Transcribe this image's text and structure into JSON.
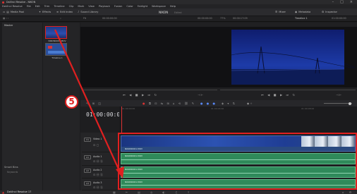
{
  "app": {
    "window_title": "DaVinci Resolve - NIKON",
    "menu": [
      "DaVinci Resolve",
      "File",
      "Edit",
      "Trim",
      "Timeline",
      "Clip",
      "Mark",
      "View",
      "Playback",
      "Fusion",
      "Color",
      "Fairlight",
      "Workspace",
      "Help"
    ],
    "project_name": "NIKON",
    "project_status": "Edited"
  },
  "toolbar": {
    "media_pool": "Media Pool",
    "effects": "Effects",
    "edit_index": "Edit Index",
    "sound_library": "Sound Library",
    "mixer": "Mixer",
    "metadata": "Metadata",
    "inspector": "Inspector"
  },
  "media_pool": {
    "master_label": "Master",
    "smart_bins_label": "Smart Bins",
    "keywords_label": "Keywords",
    "clips": [
      {
        "label": "NIKON0001.MOV"
      },
      {
        "label": "Timeline 1"
      }
    ]
  },
  "source_viewer": {
    "zoom": "Fit",
    "timecode": "00:00:00:00",
    "timecode_right": "00:00:00:00"
  },
  "timeline_viewer": {
    "zoom": "77%",
    "timecode_left": "00:00:17:09",
    "timeline_name": "Timeline 1",
    "timecode_right": "01:00:00:00"
  },
  "timeline": {
    "timecode": "01:00:00:00",
    "ruler_ticks": [
      "01:00:00:00",
      "01:00:04:00",
      "01:00:08:00"
    ],
    "tracks": [
      {
        "tag": "V1",
        "name": "Video 1",
        "clip": "NIKON0001.MOV"
      },
      {
        "tag": "A1",
        "name": "Audio 1",
        "clip": "NIKON0001.MOV"
      },
      {
        "tag": "A2",
        "name": "Audio 2",
        "clip": "NIKON0001.MOV"
      },
      {
        "tag": "A3",
        "name": "Audio 3",
        "clip": "NIKON0001.MOV"
      }
    ]
  },
  "pagebar": {
    "brand": "DaVinci Resolve 17"
  },
  "annotation": {
    "step_number": "5",
    "color": "#e02020"
  },
  "colors": {
    "accent": "#e02020",
    "video_clip": "#2a4a80",
    "audio_clip": "#2f8a5a",
    "background": "#1c1c1e"
  }
}
